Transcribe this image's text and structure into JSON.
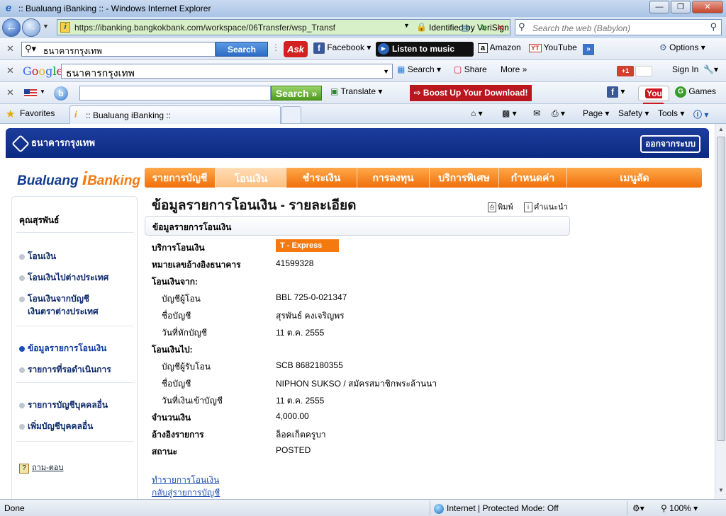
{
  "window": {
    "title": ":: Bualuang iBanking :: - Windows Internet Explorer"
  },
  "address_bar": {
    "url": "https://ibanking.bangkokbank.com/workspace/06Transfer/wsp_Transf",
    "identity": "Identified by VeriSign"
  },
  "web_search": {
    "placeholder": "Search the web (Babylon)"
  },
  "ask_toolbar": {
    "query": "ธนาคารกรุงเทพ",
    "search_label": "Search",
    "facebook_label": "Facebook",
    "music_label": "Listen to music",
    "amazon_label": "Amazon",
    "youtube_label": "YouTube",
    "options_label": "Options"
  },
  "google_toolbar": {
    "logo": "Google",
    "query": "ธนาคารกรุงเทพ",
    "search_label": "Search",
    "share_label": "Share",
    "more_label": "More »",
    "plus_label": "+1",
    "signin_label": "Sign In"
  },
  "babylon_toolbar": {
    "search_label": "Search »",
    "translate_label": "Translate",
    "boost_label": "⇨ Boost Up Your Download!",
    "youtube_label": "You Tube",
    "games_label": "Games"
  },
  "favorites_bar": {
    "favorites_label": "Favorites",
    "tab_title": ":: Bualuang iBanking ::",
    "page_label": "Page",
    "safety_label": "Safety",
    "tools_label": "Tools"
  },
  "bank": {
    "name": "ธนาคารกรุงเทพ",
    "logout_label": "ออกจากระบบ",
    "brand_prefix": "Bualuang",
    "brand_i": "i",
    "brand_suffix": "Banking",
    "nav": [
      {
        "label": "รายการบัญชี"
      },
      {
        "label": "โอนเงิน"
      },
      {
        "label": "ชำระเงิน"
      },
      {
        "label": "การลงทุน"
      },
      {
        "label": "บริการพิเศษ"
      },
      {
        "label": "กำหนดค่า"
      },
      {
        "label": "เมนูลัด"
      }
    ],
    "active_nav": "โอนเงิน"
  },
  "sidebar": {
    "user": "คุณสุรพันธ์",
    "items": [
      {
        "label": "โอนเงิน"
      },
      {
        "label": "โอนเงินไปต่างประเทศ"
      },
      {
        "label": "โอนเงินจากบัญชี"
      },
      {
        "label": "เงินตราต่างประเทศ"
      },
      {
        "label": "ข้อมูลรายการโอนเงิน"
      },
      {
        "label": "รายการที่รอดำเนินการ"
      },
      {
        "label": "รายการบัญชีบุคคลอื่น"
      },
      {
        "label": "เพิ่มบัญชีบุคคลอื่น"
      }
    ],
    "active_item": "ข้อมูลรายการโอนเงิน",
    "help_label": "ถาม-ตอบ"
  },
  "main": {
    "title": "ข้อมูลรายการโอนเงิน - รายละเอียด",
    "print_label": "พิมพ์",
    "help_label": "คำแนะนำ",
    "section_title": "ข้อมูลรายการโอนเงิน",
    "service_label": "บริการโอนเงิน",
    "service_value": "T - Express",
    "ref_label": "หมายเลขอ้างอิงธนาคาร",
    "ref_value": "41599328",
    "from_header": "โอนเงินจาก:",
    "from_account_label": "บัญชีผู้โอน",
    "from_account_value": "BBL 725-0-021347",
    "from_name_label": "ชื่อบัญชี",
    "from_name_value": "สุรพันธ์ คงเจริญพร",
    "debit_date_label": "วันที่หักบัญชี",
    "debit_date_value": "11 ต.ค. 2555",
    "to_header": "โอนเงินไป:",
    "to_account_label": "บัญชีผู้รับโอน",
    "to_account_value": "SCB 8682180355",
    "to_name_label": "ชื่อบัญชี",
    "to_name_value": "NIPHON SUKSO / สมัครสมาชิกพระล้านนา",
    "credit_date_label": "วันที่เงินเข้าบัญชี",
    "credit_date_value": "11 ต.ค. 2555",
    "amount_label": "จำนวนเงิน",
    "amount_value": "4,000.00",
    "memo_label": "อ้างอิงรายการ",
    "memo_value": "ล็อคเก็ตครูบา",
    "status_label": "สถานะ",
    "status_value": "POSTED",
    "link_new_transfer": "ทำรายการโอนเงิน",
    "link_back_accounts": "กลับสู่รายการบัญชี"
  },
  "statusbar": {
    "text": "Done",
    "zone": "Internet | Protected Mode: Off",
    "zoom": "100%"
  },
  "colors": {
    "bank_blue": "#0b2a82",
    "nav_orange": "#f47a10",
    "ie_chrome": "#dfe9f5"
  }
}
